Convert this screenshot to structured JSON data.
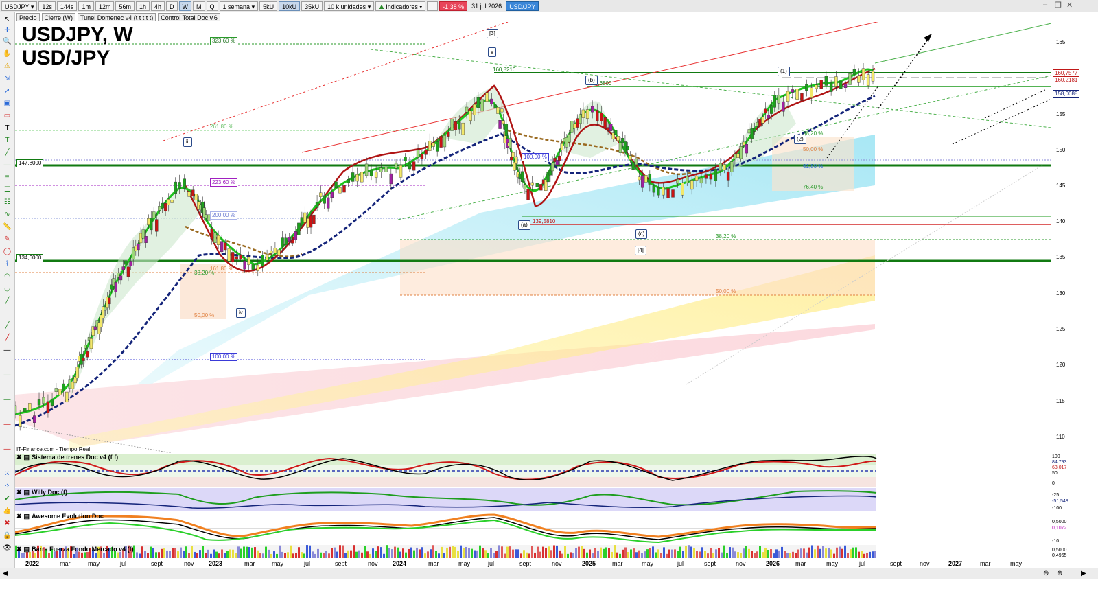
{
  "toolbar": {
    "symbol": "USDJPY",
    "intervals": [
      "12s",
      "144s",
      "1m",
      "12m",
      "56m",
      "1h",
      "4h",
      "D",
      "W",
      "M",
      "Q"
    ],
    "selected_interval": "W",
    "period": "1 semana",
    "units": [
      "5kU",
      "10kU",
      "35kU"
    ],
    "selected_unit": "10kU",
    "quantity": "10 k unidades",
    "indicators": "Indicadores",
    "change": "-1,38 %",
    "date": "31 jul 2026",
    "pair_badge": "USD/JPY"
  },
  "legend": [
    "Precio",
    "Cierre (W)",
    "Tunel Domenec v4 (t t t t t)",
    "Control Total Doc v.6"
  ],
  "chart": {
    "title_line1": "USDJPY, W",
    "title_line2": "USD/JPY",
    "price_axis": [
      "165",
      "160",
      "155",
      "150",
      "145",
      "140",
      "135",
      "130",
      "125",
      "120",
      "115",
      "110"
    ],
    "price_labels": {
      "l1": "160,7577",
      "l2": "160,2181",
      "l3": "158,0088",
      "left1": "147,8000",
      "left2": "134,6000",
      "low": "139,5810",
      "high": "160,8210",
      "mid": "158,6800"
    },
    "fib_labels": {
      "f1": "323,60 %",
      "f2": "261,80 %",
      "f3": "223,60 %",
      "f4": "200,00 %",
      "f5": "161,80 %",
      "f6": "38,20 %",
      "f7": "50,00 %",
      "f8": "100,00 %",
      "f9": "100,00 %",
      "f10": "38,20 %",
      "f11": "50,00 %",
      "f12": "38,20 %",
      "f13": "50,00 %",
      "f14": "61,80 %",
      "f15": "76,40 %"
    },
    "waves": {
      "w3": "[3]",
      "wv": "v",
      "wiii": "iii",
      "wiv": "iv",
      "wb": "(b)",
      "wa": "(a)",
      "wc": "(c)",
      "w4": "[4]",
      "w1": "(1)",
      "w2": "(2)"
    },
    "source": "IT-Finance.com - Tiempo Real"
  },
  "panels": {
    "p1": {
      "title": "Sistema de trenes Doc v4 (f f)",
      "values": [
        "100",
        "84,793",
        "63,017",
        "50",
        "0"
      ]
    },
    "p2": {
      "title": "Willy Doc (t)",
      "values": [
        "-25",
        "-51,548",
        "-100"
      ]
    },
    "p3": {
      "title": "Awesome Evolution Doc",
      "values": [
        "0,5000",
        "0,1072",
        "-10"
      ]
    },
    "p4": {
      "title": "Barra Fuerza Fondo Mercado v4 (f)",
      "values": [
        "0,5000",
        "0,4965"
      ]
    }
  },
  "xaxis": [
    "2022",
    "mar",
    "may",
    "jul",
    "sept",
    "nov",
    "2023",
    "mar",
    "may",
    "jul",
    "sept",
    "nov",
    "2024",
    "mar",
    "may",
    "jul",
    "sept",
    "nov",
    "2025",
    "mar",
    "may",
    "jul",
    "sept",
    "nov",
    "2026",
    "mar",
    "may",
    "jul",
    "sept",
    "nov",
    "2027",
    "mar",
    "may"
  ],
  "colors": {
    "up": "#1ea01e",
    "down": "#c81414",
    "support": "#117a11",
    "resist": "#d42a2a",
    "trend_blue": "#14247a"
  }
}
